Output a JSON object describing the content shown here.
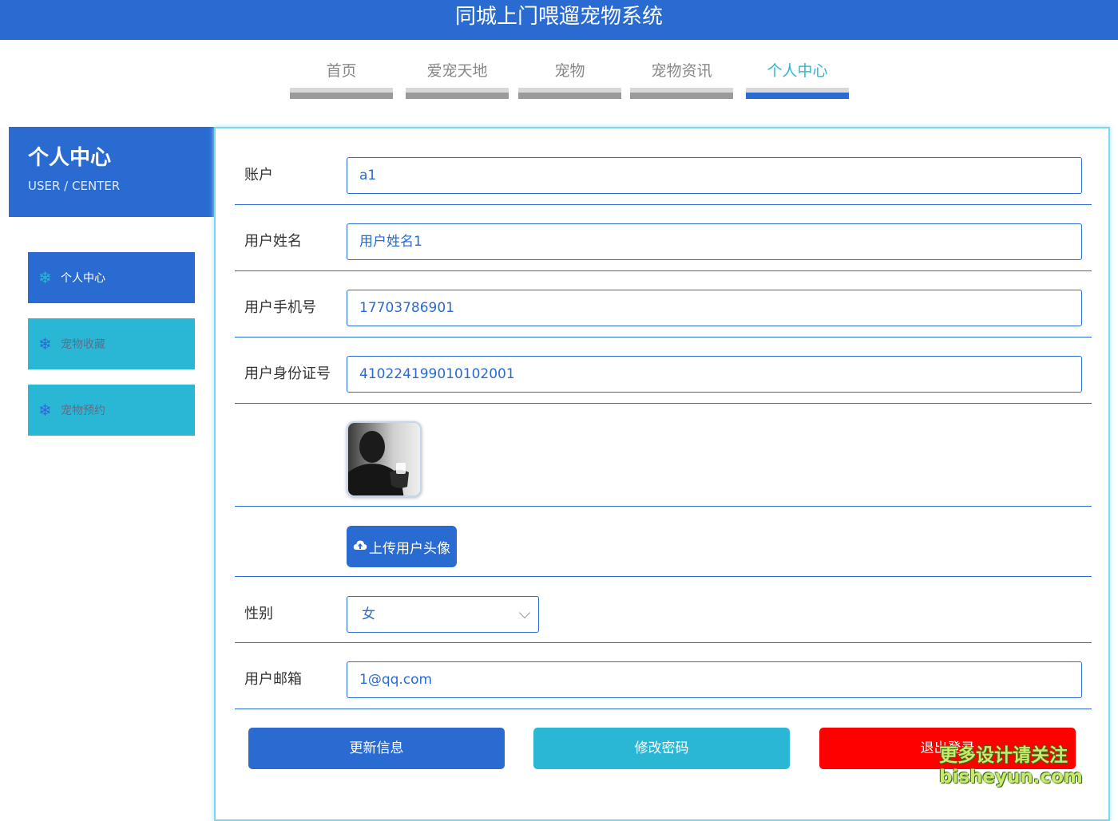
{
  "app": {
    "title": "同城上门喂遛宠物系统"
  },
  "nav": {
    "items": [
      {
        "label": "首页"
      },
      {
        "label": "爱宠天地"
      },
      {
        "label": "宠物"
      },
      {
        "label": "宠物资讯"
      },
      {
        "label": "个人中心"
      }
    ],
    "active_index": 4
  },
  "sidebar": {
    "title": "个人中心",
    "subtitle": "USER / CENTER",
    "items": [
      {
        "label": "个人中心",
        "icon": "snowflake-icon"
      },
      {
        "label": "宠物收藏",
        "icon": "snowflake-icon"
      },
      {
        "label": "宠物预约",
        "icon": "snowflake-icon"
      }
    ]
  },
  "form": {
    "account": {
      "label": "账户",
      "value": "a1"
    },
    "username": {
      "label": "用户姓名",
      "value": "用户姓名1"
    },
    "phone": {
      "label": "用户手机号",
      "value": "17703786901"
    },
    "idcard": {
      "label": "用户身份证号",
      "value": "410224199010102001"
    },
    "avatar": {
      "upload_label": "上传用户头像",
      "icon": "cloud-upload-icon"
    },
    "gender": {
      "label": "性别",
      "value": "女"
    },
    "email": {
      "label": "用户邮箱",
      "value": "1@qq.com"
    }
  },
  "actions": {
    "update": "更新信息",
    "change_password": "修改密码",
    "logout": "退出登录"
  },
  "watermark": {
    "line1": "更多设计请关注",
    "line2": "bisheyun.com"
  },
  "colors": {
    "primary": "#2a6bd1",
    "accent": "#2ab7d6",
    "danger": "#ff0000"
  }
}
